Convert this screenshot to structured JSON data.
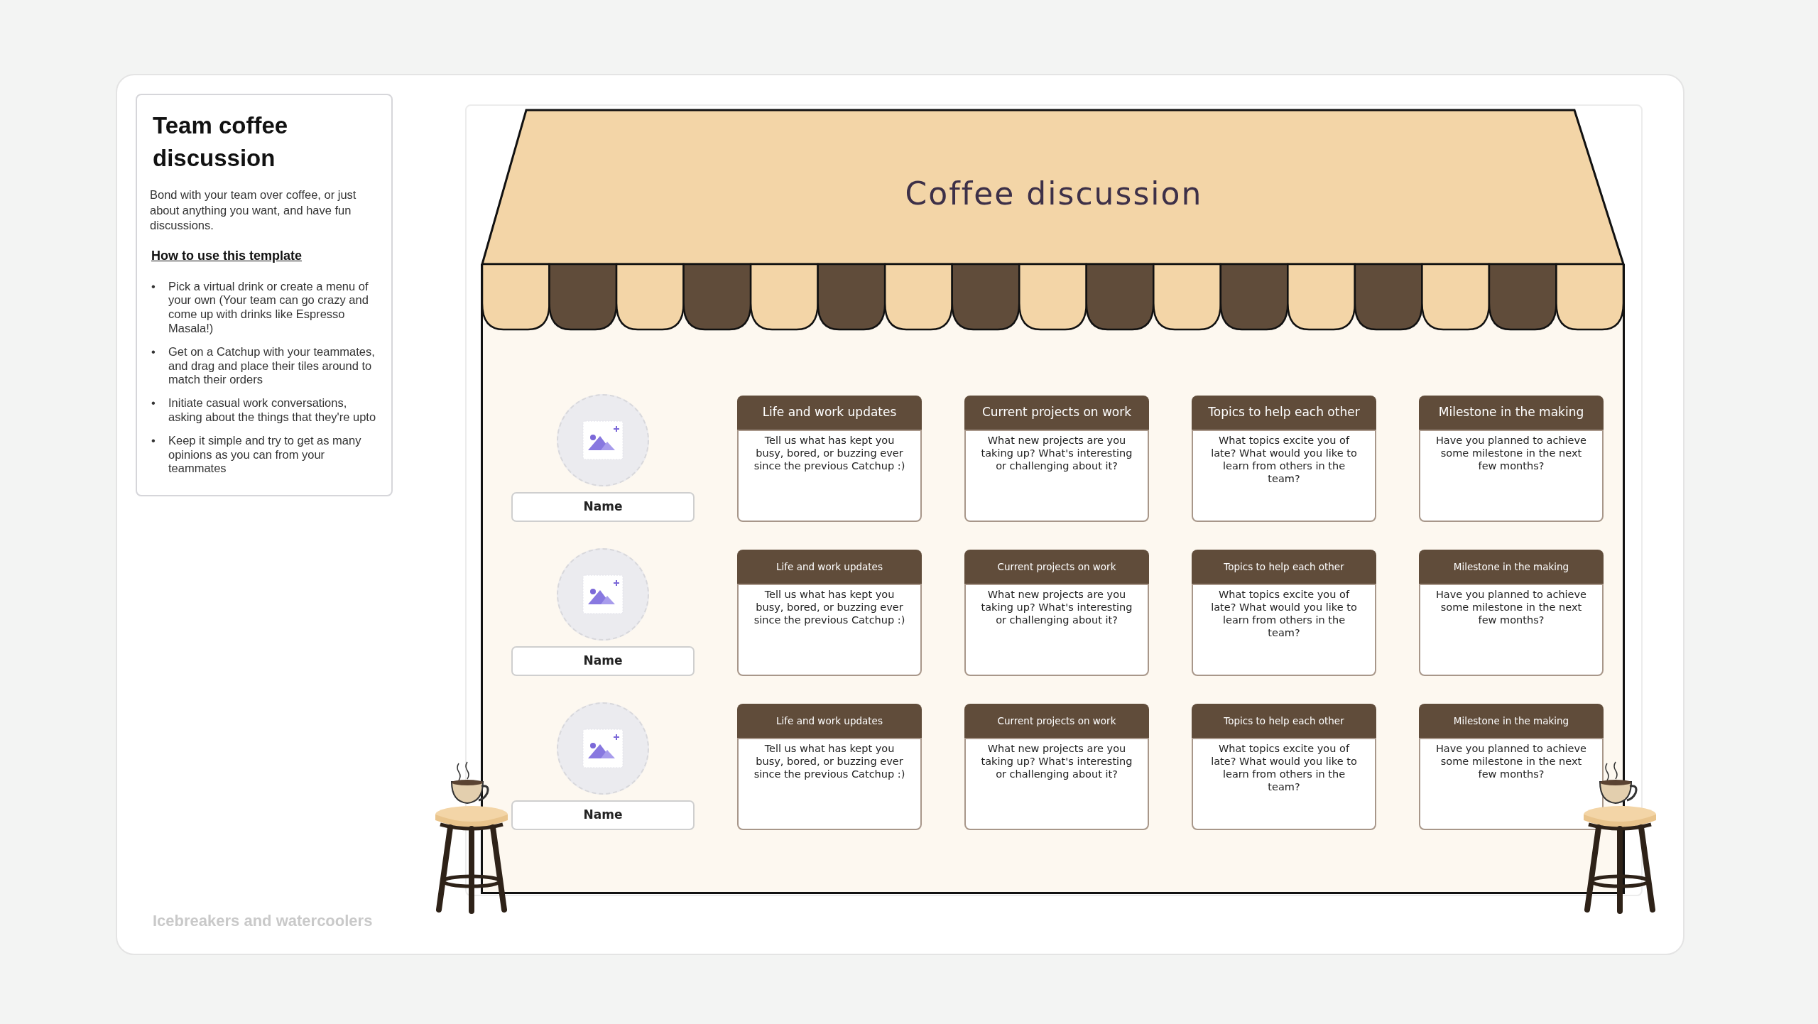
{
  "sidebar": {
    "title": "Team coffee discussion",
    "description": "Bond with your team over coffee, or just about anything you want, and have fun discussions.",
    "howto_heading": "How to use this template",
    "steps": [
      {
        "bullet": "•",
        "text": "Pick a virtual drink or create a menu of your own (Your team can go crazy and come up with drinks like Espresso Masala!)"
      },
      {
        "bullet": "•",
        "text": "Get on a Catchup with your teammates, and drag and place their tiles around to match their orders"
      },
      {
        "bullet": "•",
        "text": "Initiate casual work conversations, asking about the things that they're upto"
      },
      {
        "bullet": "•",
        "text": "Keep it simple and try to get as many opinions as you can from your teammates"
      }
    ]
  },
  "board": {
    "title": "Coffee discussion",
    "rows": [
      {
        "name": "Name",
        "prompts": [
          {
            "heading": "Life and work updates",
            "text": "Tell us what has kept you busy, bored, or buzzing ever since the previous Catchup :)"
          },
          {
            "heading": "Current projects on work",
            "text": "What new projects are you taking up? What's interesting or challenging about it?"
          },
          {
            "heading": "Topics to help each other",
            "text": "What topics excite you of late? What would you like to learn from others in the team?"
          },
          {
            "heading": "Milestone in the making",
            "text": "Have you planned to achieve some milestone in the next few months?"
          }
        ]
      },
      {
        "name": "Name",
        "prompts": [
          {
            "heading": "Life and work updates",
            "text": "Tell us what has kept you busy, bored, or buzzing ever since the previous Catchup :)"
          },
          {
            "heading": "Current projects on work",
            "text": "What new projects are you taking up? What's interesting or challenging about it?"
          },
          {
            "heading": "Topics to help each other",
            "text": "What topics excite you of late? What would you like to learn from others in the team?"
          },
          {
            "heading": "Milestone in the making",
            "text": "Have you planned to achieve some milestone in the next few months?"
          }
        ]
      },
      {
        "name": "Name",
        "prompts": [
          {
            "heading": "Life and work updates",
            "text": "Tell us what has kept you busy, bored, or buzzing ever since the previous Catchup :)"
          },
          {
            "heading": "Current projects on work",
            "text": "What new projects are you taking up? What's interesting or challenging about it?"
          },
          {
            "heading": "Topics to help each other",
            "text": "What topics excite you of late? What would you like to learn from others in the team?"
          },
          {
            "heading": "Milestone in the making",
            "text": "Have you planned to achieve some milestone in the next few months?"
          }
        ]
      }
    ]
  },
  "footer": "Icebreakers and watercoolers"
}
